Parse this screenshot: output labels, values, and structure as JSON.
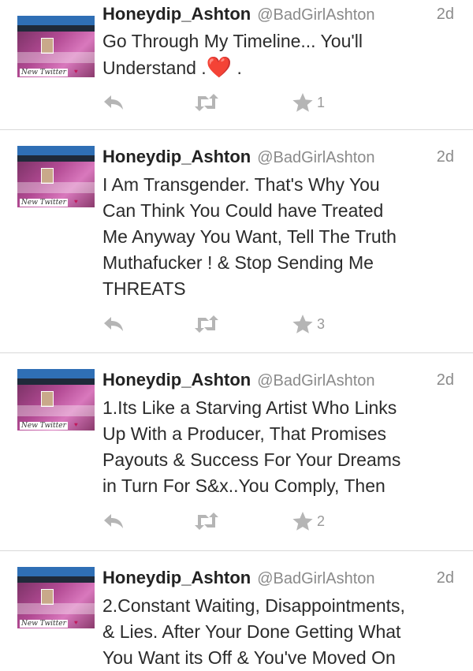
{
  "colors": {
    "icon_gray": "#b5b5b5",
    "text": "#2b2b2b",
    "muted": "#8a8a8a",
    "divider": "#d9d9d9"
  },
  "tweets": [
    {
      "name": "Honeydip_Ashton",
      "handle": "@BadGirlAshton",
      "time": "2d",
      "text_lines": [
        "Go Through My Timeline... You'll"
      ],
      "text_tail": "Understand .",
      "emoji": "❤️",
      "text_end": ".",
      "favorites": "1",
      "avatar_caption": "New Twitter"
    },
    {
      "name": "Honeydip_Ashton",
      "handle": "@BadGirlAshton",
      "time": "2d",
      "text_lines": [
        "I Am Transgender. That's Why You",
        "Can Think You Could have Treated",
        "Me Anyway You Want, Tell The Truth",
        "Muthafucker ! & Stop Sending Me",
        "THREATS"
      ],
      "favorites": "3",
      "avatar_caption": "New Twitter"
    },
    {
      "name": "Honeydip_Ashton",
      "handle": "@BadGirlAshton",
      "time": "2d",
      "text_lines": [
        "1.Its Like a Starving Artist Who Links",
        "Up With a Producer, That Promises",
        "Payouts & Success For Your Dreams",
        "in Turn For S&x..You Comply, Then"
      ],
      "favorites": "2",
      "avatar_caption": "New Twitter"
    },
    {
      "name": "Honeydip_Ashton",
      "handle": "@BadGirlAshton",
      "time": "2d",
      "text_lines": [
        "2.Constant Waiting, Disappointments,",
        "& Lies. After Your Done Getting What",
        "You Want its Off & You've Moved On"
      ],
      "avatar_caption": "New Twitter"
    }
  ]
}
